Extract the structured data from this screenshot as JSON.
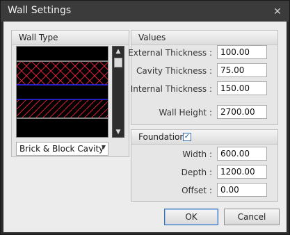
{
  "window": {
    "title": "Wall Settings"
  },
  "wall_type": {
    "group_title": "Wall Type",
    "selected": "Brick & Block Cavity"
  },
  "values": {
    "group_title": "Values",
    "external_label": "External Thickness :",
    "external_value": "100.00",
    "cavity_label": "Cavity Thickness :",
    "cavity_value": "75.00",
    "internal_label": "Internal Thickness :",
    "internal_value": "150.00",
    "height_label": "Wall Height :",
    "height_value": "2700.00"
  },
  "foundations": {
    "group_title": "Foundations",
    "enabled": true,
    "width_label": "Width :",
    "width_value": "600.00",
    "depth_label": "Depth :",
    "depth_value": "1200.00",
    "offset_label": "Offset :",
    "offset_value": "0.00"
  },
  "buttons": {
    "ok": "OK",
    "cancel": "Cancel"
  },
  "icons": {
    "close": "close-icon",
    "scroll_up": "scroll-up-icon",
    "scroll_down": "scroll-down-icon",
    "dropdown": "chevron-down-icon",
    "check": "checkmark-icon"
  },
  "colors": {
    "hatch": "#e0203a",
    "line": "#2a2aff",
    "preview_bg": "#000000"
  }
}
